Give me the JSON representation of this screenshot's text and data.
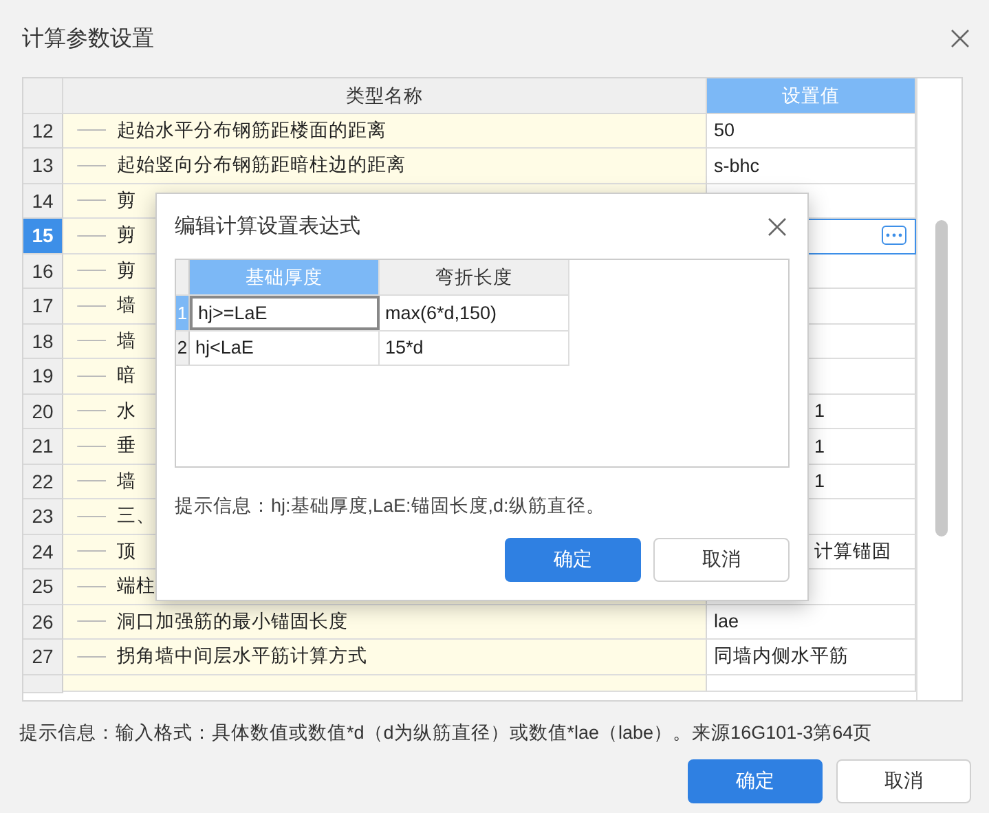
{
  "window": {
    "title": "计算参数设置"
  },
  "table": {
    "columns": [
      "类型名称",
      "设置值"
    ],
    "rows": [
      {
        "number": "12",
        "name": "起始水平分布钢筋距楼面的距离",
        "value": "50",
        "selected": false
      },
      {
        "number": "13",
        "name": "起始竖向分布钢筋距暗柱边的距离",
        "value": "s-bhc",
        "selected": false
      },
      {
        "number": "14",
        "name": "剪",
        "selected": false
      },
      {
        "number": "15",
        "name": "剪",
        "selected": true
      },
      {
        "number": "16",
        "name": "剪",
        "selected": false
      },
      {
        "number": "17",
        "name": "墙",
        "selected": false
      },
      {
        "number": "18",
        "name": "墙",
        "selected": false
      },
      {
        "number": "19",
        "name": "暗",
        "selected": false
      },
      {
        "number": "20",
        "name": "水",
        "value_tail": "1",
        "selected": false
      },
      {
        "number": "21",
        "name": "垂",
        "value_tail": "1",
        "selected": false
      },
      {
        "number": "22",
        "name": "墙",
        "value_tail": "1",
        "selected": false
      },
      {
        "number": "23",
        "name": "三、",
        "selected": false
      },
      {
        "number": "24",
        "name": "顶",
        "value_tail": "计算锚固",
        "selected": false
      },
      {
        "number": "25",
        "name": "端柱",
        "selected": false
      },
      {
        "number": "26",
        "name": "洞口加强筋的最小锚固长度",
        "value": "lae",
        "selected": false
      },
      {
        "number": "27",
        "name": "拐角墙中间层水平筋计算方式",
        "value": "同墙内侧水平筋",
        "selected": false
      }
    ]
  },
  "hint": "提示信息：输入格式：具体数值或数值*d（d为纵筋直径）或数值*lae（labe）。来源16G101-3第64页",
  "buttons": [
    {
      "label": "确定",
      "kind": "primary"
    },
    {
      "label": "取消",
      "kind": "secondary"
    }
  ],
  "modal": {
    "title": "编辑计算设置表达式",
    "columns": [
      {
        "label": "基础厚度",
        "selected": true
      },
      {
        "label": "弯折长度",
        "selected": false
      }
    ],
    "rows": [
      {
        "number": "1",
        "cells": [
          "hj>=LaE",
          "max(6*d,150)"
        ],
        "selected": true
      },
      {
        "number": "2",
        "cells": [
          "hj<LaE",
          "15*d"
        ],
        "selected": false
      }
    ],
    "hint": "提示信息：hj:基础厚度,LaE:锚固长度,d:纵筋直径。",
    "buttons": [
      {
        "label": "确定",
        "kind": "primary"
      },
      {
        "label": "取消",
        "kind": "secondary"
      }
    ]
  }
}
